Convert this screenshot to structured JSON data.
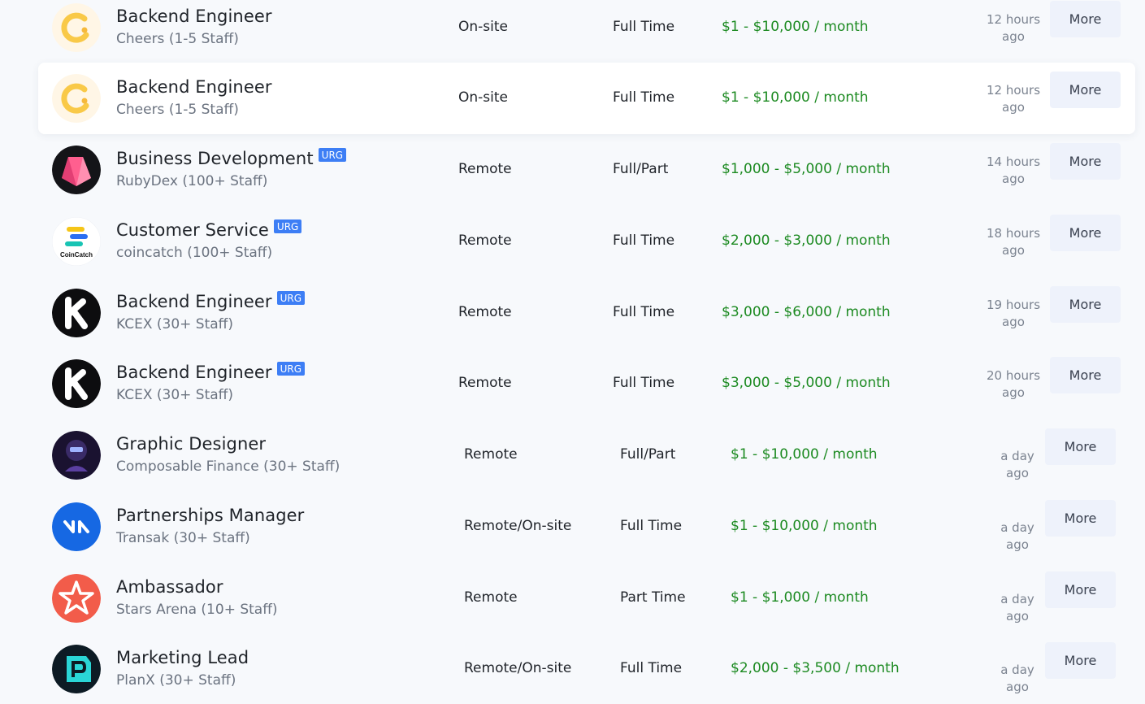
{
  "jobs": [
    {
      "title": "Backend Engineer",
      "company": "Cheers (1-5 Staff)",
      "urgent": false,
      "urgent_label": "",
      "location": "On-site",
      "type": "Full Time",
      "salary": "$1 - $10,000 / month",
      "posted_line1": "12 hours",
      "posted_line2": "ago",
      "more_label": "More",
      "logo": "cheers-logo-icon"
    },
    {
      "title": "Backend Engineer",
      "company": "Cheers (1-5 Staff)",
      "urgent": false,
      "urgent_label": "",
      "location": "On-site",
      "type": "Full Time",
      "salary": "$1 - $10,000 / month",
      "posted_line1": "12 hours",
      "posted_line2": "ago",
      "more_label": "More",
      "logo": "cheers-logo-icon"
    },
    {
      "title": "Business Development",
      "company": "RubyDex (100+ Staff)",
      "urgent": true,
      "urgent_label": "URG",
      "location": "Remote",
      "type": "Full/Part",
      "salary": "$1,000 - $5,000 / month",
      "posted_line1": "14 hours",
      "posted_line2": "ago",
      "more_label": "More",
      "logo": "rubydex-logo-icon"
    },
    {
      "title": "Customer Service",
      "company": "coincatch (100+ Staff)",
      "urgent": true,
      "urgent_label": "URG",
      "location": "Remote",
      "type": "Full Time",
      "salary": "$2,000 - $3,000 / month",
      "posted_line1": "18 hours",
      "posted_line2": "ago",
      "more_label": "More",
      "logo": "coincatch-logo-icon",
      "logo_text": "CoinCatch"
    },
    {
      "title": "Backend Engineer",
      "company": "KCEX (30+ Staff)",
      "urgent": true,
      "urgent_label": "URG",
      "location": "Remote",
      "type": "Full Time",
      "salary": "$3,000 - $6,000 / month",
      "posted_line1": "19 hours",
      "posted_line2": "ago",
      "more_label": "More",
      "logo": "kcex-logo-icon"
    },
    {
      "title": "Backend Engineer",
      "company": "KCEX (30+ Staff)",
      "urgent": true,
      "urgent_label": "URG",
      "location": "Remote",
      "type": "Full Time",
      "salary": "$3,000 - $5,000 / month",
      "posted_line1": "20 hours",
      "posted_line2": "ago",
      "more_label": "More",
      "logo": "kcex-logo-icon"
    },
    {
      "title": "Graphic Designer",
      "company": "Composable Finance (30+ Staff)",
      "urgent": false,
      "urgent_label": "",
      "location": "Remote",
      "type": "Full/Part",
      "salary": "$1 - $10,000 / month",
      "posted_line1": "a day ago",
      "posted_line2": "",
      "more_label": "More",
      "logo": "composable-logo-icon"
    },
    {
      "title": "Partnerships Manager",
      "company": "Transak (30+ Staff)",
      "urgent": false,
      "urgent_label": "",
      "location": "Remote/On-site",
      "type": "Full Time",
      "salary": "$1 - $10,000 / month",
      "posted_line1": "a day ago",
      "posted_line2": "",
      "more_label": "More",
      "logo": "transak-logo-icon"
    },
    {
      "title": "Ambassador",
      "company": "Stars Arena (10+ Staff)",
      "urgent": false,
      "urgent_label": "",
      "location": "Remote",
      "type": "Part Time",
      "salary": "$1 - $1,000 / month",
      "posted_line1": "a day ago",
      "posted_line2": "",
      "more_label": "More",
      "logo": "stars-arena-logo-icon"
    },
    {
      "title": "Marketing Lead",
      "company": "PlanX (30+ Staff)",
      "urgent": false,
      "urgent_label": "",
      "location": "Remote/On-site",
      "type": "Full Time",
      "salary": "$2,000 - $3,500 / month",
      "posted_line1": "a day ago",
      "posted_line2": "",
      "more_label": "More",
      "logo": "planx-logo-icon"
    }
  ],
  "colors": {
    "salary": "#1c8a21",
    "urgent_badge": "#3d7ef5",
    "more_button_bg": "#eef2fb",
    "page_bg": "#f7f9fc"
  }
}
